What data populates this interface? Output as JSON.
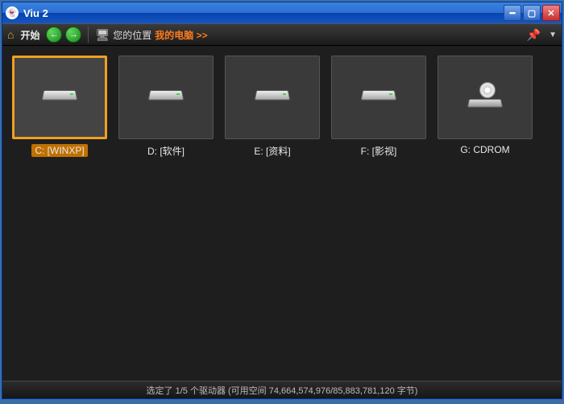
{
  "window": {
    "title": "Viu 2",
    "icon_glyph": "👻"
  },
  "toolbar": {
    "start_label": "开始",
    "location_label": "您的位置",
    "location_path": "我的电脑 >>"
  },
  "drives": [
    {
      "id": "c",
      "label": "C: [WINXP]",
      "type": "hdd",
      "selected": true
    },
    {
      "id": "d",
      "label": "D: [软件]",
      "type": "hdd",
      "selected": false
    },
    {
      "id": "e",
      "label": "E: [资料]",
      "type": "hdd",
      "selected": false
    },
    {
      "id": "f",
      "label": "F: [影视]",
      "type": "hdd",
      "selected": false
    },
    {
      "id": "g",
      "label": "G: CDROM",
      "type": "cd",
      "selected": false
    }
  ],
  "status": {
    "text": "选定了 1/5 个驱动器 (可用空间 74,664,574,976/85,883,781,120 字节)"
  }
}
